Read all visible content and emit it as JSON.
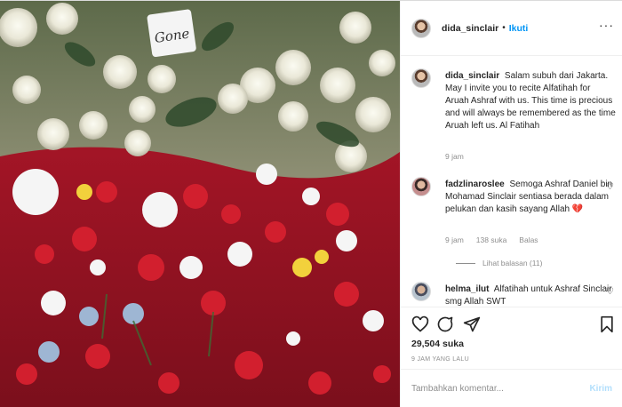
{
  "post": {
    "username": "dida_sinclair",
    "follow_label": "Ikuti",
    "dot": "•",
    "more_label": "···"
  },
  "photo": {
    "sign_text": "Gone",
    "description": "Flower petals on grave"
  },
  "caption": {
    "username": "dida_sinclair",
    "text": "Salam subuh dari Jakarta. May I invite you to recite Alfatihah for Aruah Ashraf with us. This time is precious and will always be remembered as the time Aruah left us. Al Fatihah",
    "time": "9 jam"
  },
  "comments": [
    {
      "username": "fadzlinaroslee",
      "text": "Semoga Ashraf Daniel bin Mohamad Sinclair sentiasa berada dalam pelukan dan kasih sayang Allah",
      "emoji": "💔",
      "time": "9 jam",
      "likes": "138 suka",
      "reply": "Balas",
      "view_replies": "Lihat balasan (11)"
    },
    {
      "username": "helma_ilut",
      "text": "Alfatihah untuk Ashraf Sinclair smg Allah SWT"
    }
  ],
  "actions": {
    "like_count": "29,504 suka",
    "time_ago": "9 JAM YANG LALU"
  },
  "add_comment": {
    "placeholder": "Tambahkan komentar...",
    "send_label": "Kirim"
  },
  "colors": {
    "link_blue": "#0095f6",
    "muted": "#8e8e8e",
    "send_disabled": "#b2dffc",
    "heart_red": "#ed4956"
  }
}
